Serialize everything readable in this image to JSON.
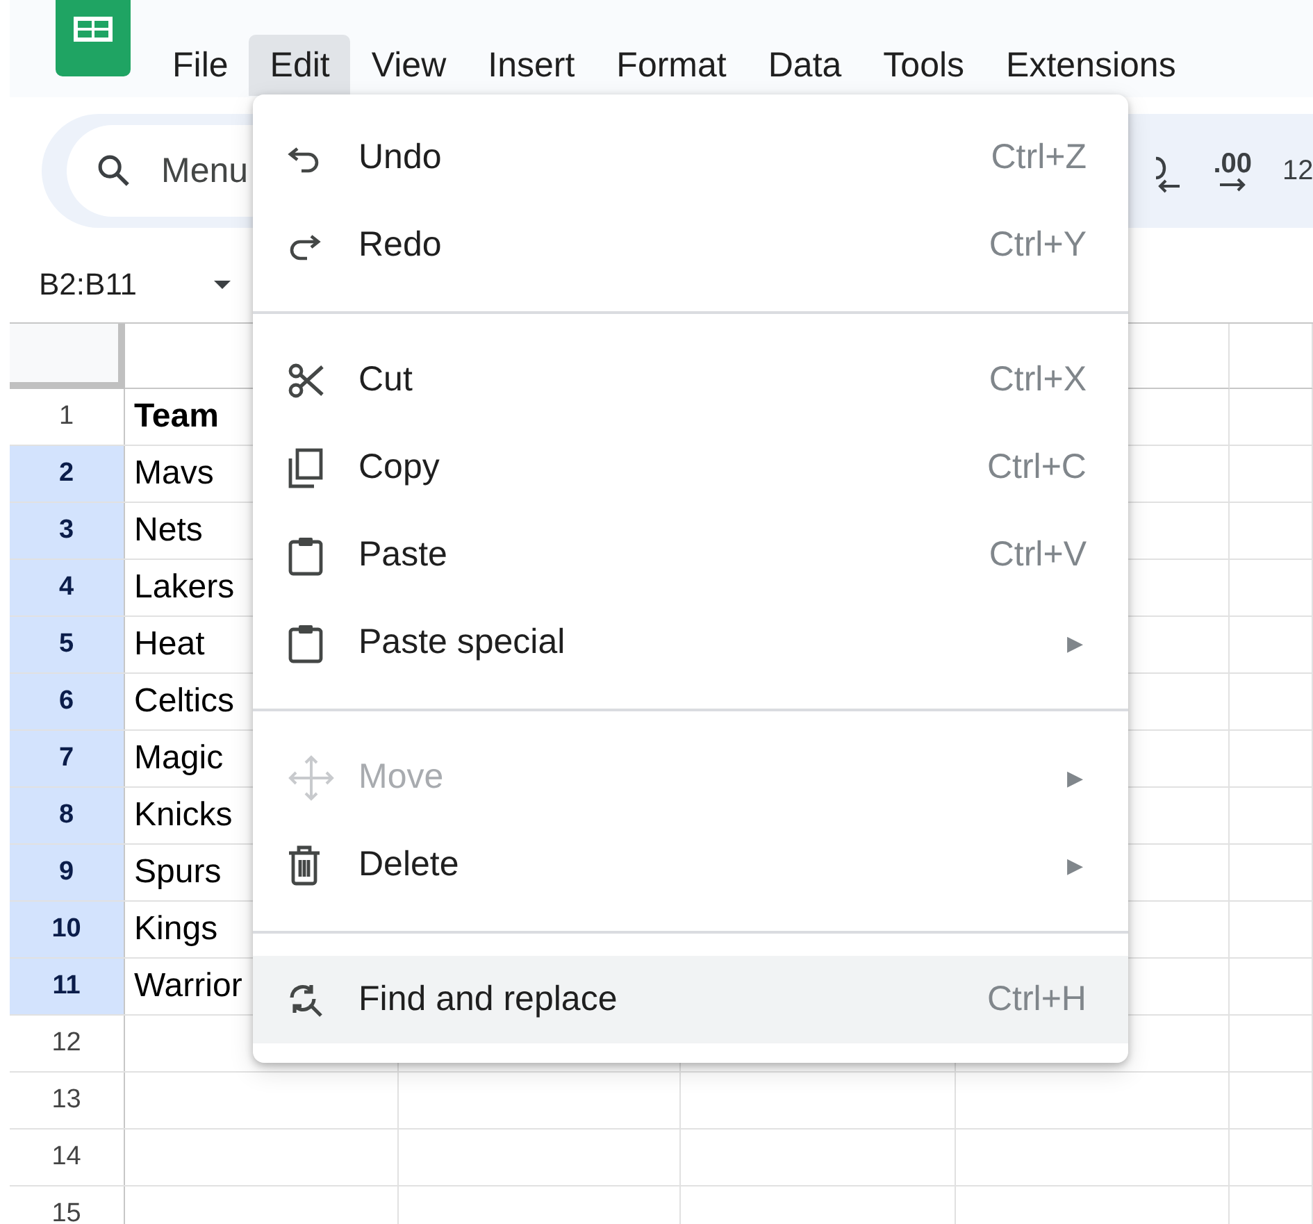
{
  "menubar": [
    {
      "label": "File",
      "selected": false
    },
    {
      "label": "Edit",
      "selected": true
    },
    {
      "label": "View",
      "selected": false
    },
    {
      "label": "Insert",
      "selected": false
    },
    {
      "label": "Format",
      "selected": false
    },
    {
      "label": "Data",
      "selected": false
    },
    {
      "label": "Tools",
      "selected": false
    },
    {
      "label": "Extensions",
      "selected": false
    }
  ],
  "toolbar": {
    "search": {
      "placeholder": "Menu"
    },
    "decimal_label": ".00",
    "zoom_text": "12"
  },
  "name_box": "B2:B11",
  "sheet": {
    "rows": [
      {
        "header": "1",
        "selected": false,
        "cells": [
          {
            "text": "Team",
            "bold": true
          }
        ]
      },
      {
        "header": "2",
        "selected": true,
        "cells": [
          {
            "text": "Mavs",
            "bold": false
          }
        ]
      },
      {
        "header": "3",
        "selected": true,
        "cells": [
          {
            "text": "Nets",
            "bold": false
          }
        ]
      },
      {
        "header": "4",
        "selected": true,
        "cells": [
          {
            "text": "Lakers",
            "bold": false
          }
        ]
      },
      {
        "header": "5",
        "selected": true,
        "cells": [
          {
            "text": "Heat",
            "bold": false
          }
        ]
      },
      {
        "header": "6",
        "selected": true,
        "cells": [
          {
            "text": "Celtics",
            "bold": false
          }
        ]
      },
      {
        "header": "7",
        "selected": true,
        "cells": [
          {
            "text": "Magic",
            "bold": false
          }
        ]
      },
      {
        "header": "8",
        "selected": true,
        "cells": [
          {
            "text": "Knicks",
            "bold": false
          }
        ]
      },
      {
        "header": "9",
        "selected": true,
        "cells": [
          {
            "text": "Spurs",
            "bold": false
          }
        ]
      },
      {
        "header": "10",
        "selected": true,
        "cells": [
          {
            "text": "Kings",
            "bold": false
          }
        ]
      },
      {
        "header": "11",
        "selected": true,
        "cells": [
          {
            "text": "Warrior",
            "bold": false
          }
        ]
      },
      {
        "header": "12",
        "selected": false,
        "cells": []
      },
      {
        "header": "13",
        "selected": false,
        "cells": []
      },
      {
        "header": "14",
        "selected": false,
        "cells": []
      },
      {
        "header": "15",
        "selected": false,
        "cells": []
      }
    ]
  },
  "edit_menu": {
    "groups": [
      [
        {
          "label": "Undo",
          "kind": "undo",
          "shortcut": "Ctrl+Z",
          "disabled": false,
          "highlighted": false
        },
        {
          "label": "Redo",
          "kind": "redo",
          "shortcut": "Ctrl+Y",
          "disabled": false,
          "highlighted": false
        }
      ],
      [
        {
          "label": "Cut",
          "kind": "cut",
          "shortcut": "Ctrl+X",
          "disabled": false,
          "highlighted": false
        },
        {
          "label": "Copy",
          "kind": "copy",
          "shortcut": "Ctrl+C",
          "disabled": false,
          "highlighted": false
        },
        {
          "label": "Paste",
          "kind": "paste",
          "shortcut": "Ctrl+V",
          "disabled": false,
          "highlighted": false
        },
        {
          "label": "Paste special",
          "kind": "paste",
          "submenu_mark": "▶",
          "disabled": false,
          "highlighted": false
        }
      ],
      [
        {
          "label": "Move",
          "kind": "move",
          "submenu_mark": "▶",
          "disabled": true,
          "highlighted": false
        },
        {
          "label": "Delete",
          "kind": "delete",
          "submenu_mark": "▶",
          "disabled": false,
          "highlighted": false
        }
      ],
      [
        {
          "label": "Find and replace",
          "kind": "find-replace",
          "shortcut": "Ctrl+H",
          "disabled": false,
          "highlighted": true
        }
      ]
    ]
  }
}
